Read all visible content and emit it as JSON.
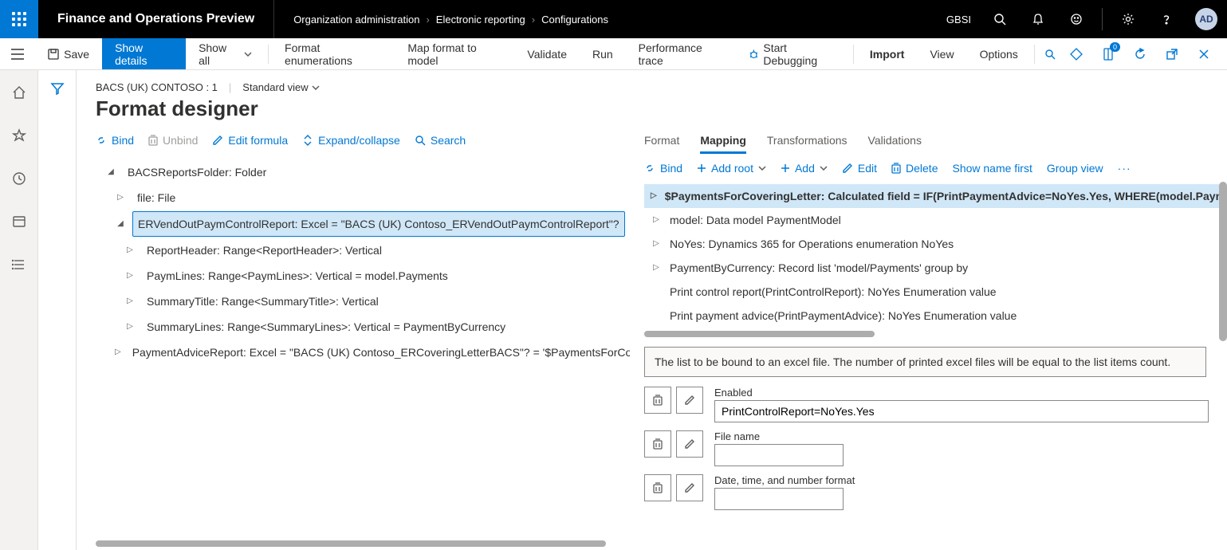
{
  "header": {
    "app_title": "Finance and Operations Preview",
    "breadcrumb": [
      "Organization administration",
      "Electronic reporting",
      "Configurations"
    ],
    "company": "GBSI",
    "avatar_initials": "AD"
  },
  "action_bar": {
    "save": "Save",
    "show_details": "Show details",
    "show_all": "Show all",
    "format_enum": "Format enumerations",
    "map_format": "Map format to model",
    "validate": "Validate",
    "run": "Run",
    "perf_trace": "Performance trace",
    "start_debugging": "Start Debugging",
    "import": "Import",
    "view": "View",
    "options": "Options",
    "badge": "0"
  },
  "page": {
    "meta_left": "BACS (UK) CONTOSO : 1",
    "meta_view": "Standard view",
    "title": "Format designer"
  },
  "left_toolbar": {
    "bind": "Bind",
    "unbind": "Unbind",
    "edit_formula": "Edit formula",
    "expand_collapse": "Expand/collapse",
    "search": "Search"
  },
  "format_tree": {
    "n0": "BACSReportsFolder: Folder",
    "n1": "file: File",
    "n2": "ERVendOutPaymControlReport: Excel = \"BACS (UK) Contoso_ERVendOutPaymControlReport\"?",
    "n3": "ReportHeader: Range<ReportHeader>: Vertical",
    "n4": "PaymLines: Range<PaymLines>: Vertical = model.Payments",
    "n5": "SummaryTitle: Range<SummaryTitle>: Vertical",
    "n6": "SummaryLines: Range<SummaryLines>: Vertical = PaymentByCurrency",
    "n7": "PaymentAdviceReport: Excel = \"BACS (UK) Contoso_ERCoveringLetterBACS\"? = '$PaymentsForCo"
  },
  "right_tabs": {
    "format": "Format",
    "mapping": "Mapping",
    "transformations": "Transformations",
    "validations": "Validations"
  },
  "right_toolbar": {
    "bind": "Bind",
    "add_root": "Add root",
    "add": "Add",
    "edit": "Edit",
    "delete": "Delete",
    "show_name_first": "Show name first",
    "group_view": "Group view"
  },
  "mapping_tree": {
    "m0": "$PaymentsForCoveringLetter: Calculated field = IF(PrintPaymentAdvice=NoYes.Yes, WHERE(model.Payn",
    "m1": "model: Data model PaymentModel",
    "m2": "NoYes: Dynamics 365 for Operations enumeration NoYes",
    "m3": "PaymentByCurrency: Record list 'model/Payments' group by",
    "m4": "Print control report(PrintControlReport): NoYes Enumeration value",
    "m5": "Print payment advice(PrintPaymentAdvice): NoYes Enumeration value"
  },
  "description": "The list to be bound to an excel file. The number of printed excel files will be equal to the list items count.",
  "fields": {
    "enabled_label": "Enabled",
    "enabled_value": "PrintControlReport=NoYes.Yes",
    "filename_label": "File name",
    "filename_value": "",
    "dateformat_label": "Date, time, and number format",
    "dateformat_value": ""
  }
}
